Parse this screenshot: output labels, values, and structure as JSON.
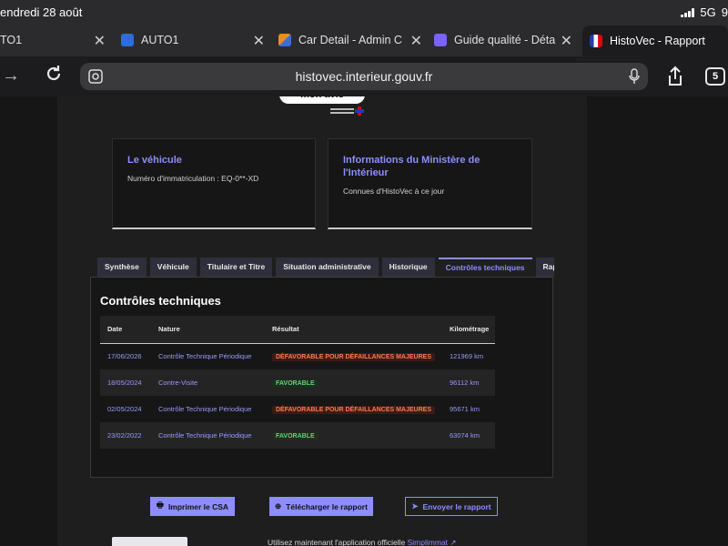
{
  "statusbar": {
    "time": "endredi 28 août",
    "network": "5G",
    "battery": "9"
  },
  "browser": {
    "tabs": [
      {
        "title": "TO1",
        "favicon_color": "#4a4a4a"
      },
      {
        "title": "AUTO1",
        "favicon_color": "#2d6cdf"
      },
      {
        "title": "Car Detail - Admin C",
        "favicon_color": "#f08a24"
      },
      {
        "title": "Guide qualité - Déta",
        "favicon_color": "#7b61ff"
      },
      {
        "title": "HistoVec - Rapport",
        "favicon_color": "#ffffff"
      }
    ],
    "url": "histovec.interieur.gouv.fr",
    "tab_count": "5"
  },
  "page": {
    "avis_label": "mon avis",
    "vehicle_card": {
      "title": "Le véhicule",
      "text": "Numéro d'immatriculation : EQ-0**-XD"
    },
    "ministry_card": {
      "title_line1": "Informations du Ministère de",
      "title_line2": "l'Intérieur",
      "text": "Connues d'HistoVec à ce jour"
    },
    "tabs": [
      "Synthèse",
      "Véhicule",
      "Titulaire et Titre",
      "Situation administrative",
      "Historique",
      "Contrôles techniques",
      "Rap"
    ],
    "active_tab_index": 5,
    "section_title": "Contrôles techniques",
    "table": {
      "headers": [
        "Date",
        "Nature",
        "Résultat",
        "Kilométrage"
      ],
      "rows": [
        {
          "date": "17/06/2026",
          "nature": "Contrôle Technique Périodique",
          "result": "DÉFAVORABLE POUR DÉFAILLANCES MAJEURES",
          "status": "bad",
          "km": "121969 km"
        },
        {
          "date": "18/05/2024",
          "nature": "Contre-Visite",
          "result": "FAVORABLE",
          "status": "good",
          "km": "96112 km"
        },
        {
          "date": "02/05/2024",
          "nature": "Contrôle Technique Périodique",
          "result": "DÉFAVORABLE POUR DÉFAILLANCES MAJEURES",
          "status": "bad",
          "km": "95671 km"
        },
        {
          "date": "23/02/2022",
          "nature": "Contrôle Technique Périodique",
          "result": "FAVORABLE",
          "status": "good",
          "km": "63074 km"
        }
      ]
    },
    "actions": {
      "print": "Imprimer le CSA",
      "download": "Télécharger le rapport",
      "send": "Envoyer le rapport"
    },
    "footnote": {
      "text": "Utilisez maintenant l'application officielle",
      "link": "Simplimmat"
    },
    "colors": {
      "accent": "#8d8dff",
      "danger": "#ff7a4d",
      "success": "#5fd27a"
    }
  }
}
